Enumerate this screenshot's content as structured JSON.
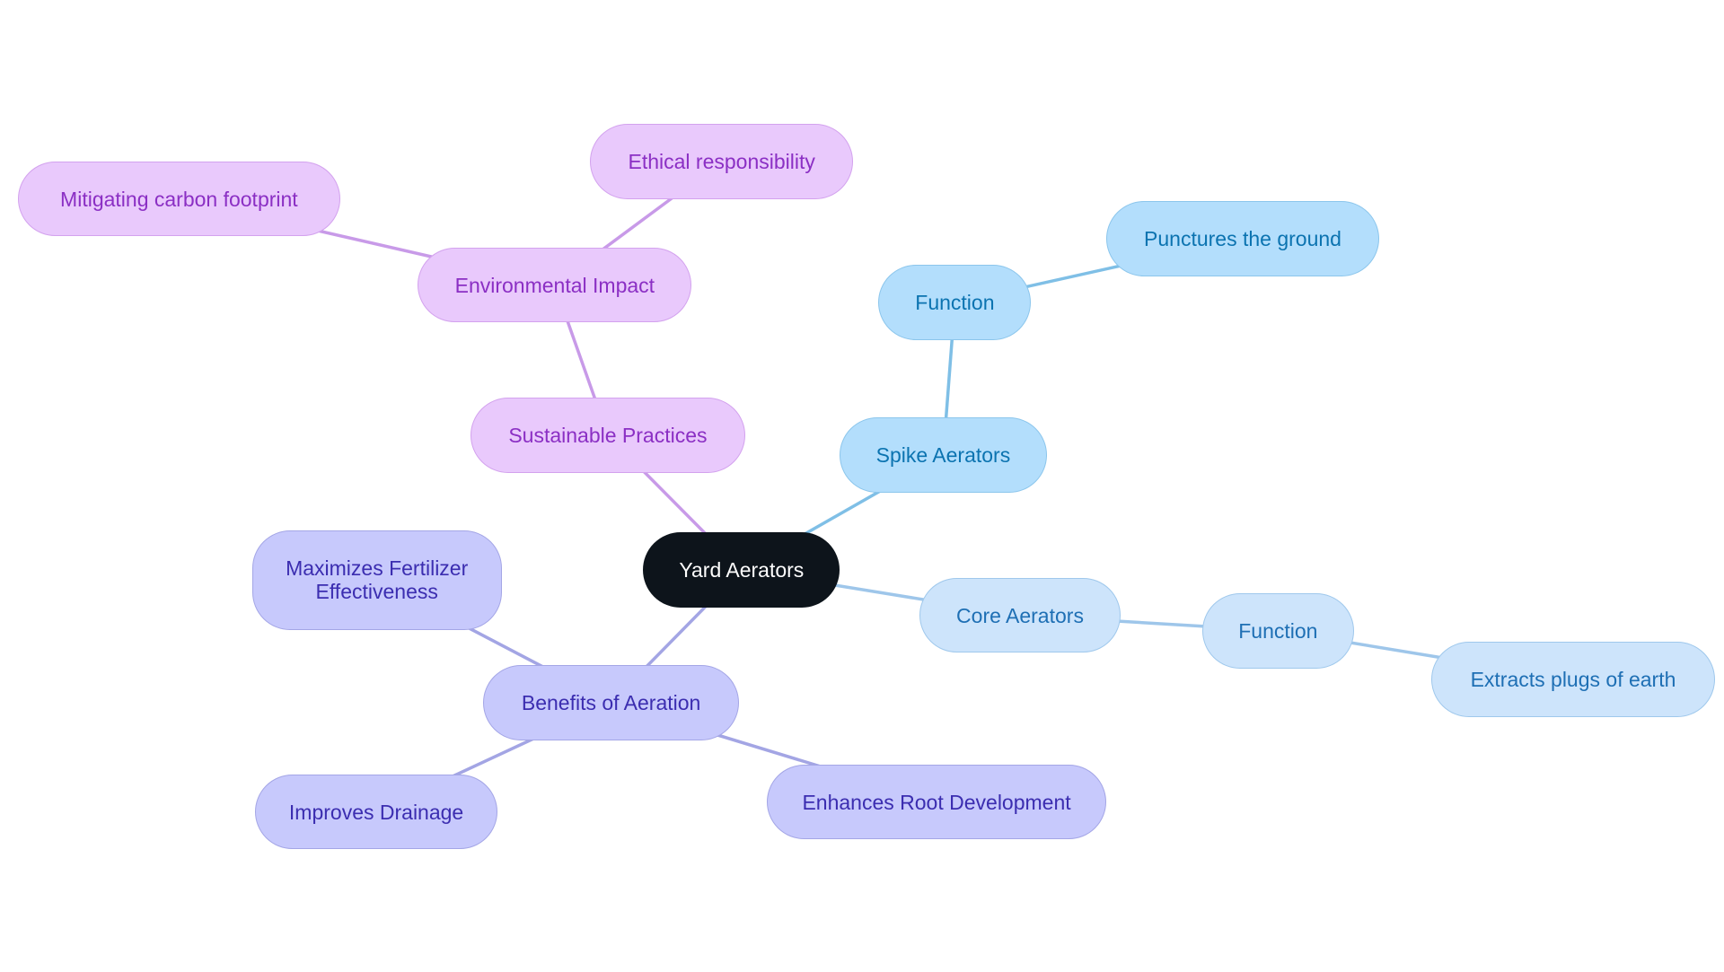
{
  "diagram": {
    "type": "mind-map",
    "root": "root",
    "nodes": [
      {
        "id": "root",
        "label": "Yard Aerators",
        "style": "root"
      },
      {
        "id": "sust",
        "label": "Sustainable Practices",
        "style": "purple"
      },
      {
        "id": "env",
        "label": "Environmental Impact",
        "style": "purple"
      },
      {
        "id": "eth",
        "label": "Ethical responsibility",
        "style": "purple"
      },
      {
        "id": "carb",
        "label": "Mitigating carbon footprint",
        "style": "purple"
      },
      {
        "id": "spike",
        "label": "Spike Aerators",
        "style": "blue"
      },
      {
        "id": "sfunc",
        "label": "Function",
        "style": "blue"
      },
      {
        "id": "punct",
        "label": "Punctures the ground",
        "style": "blue"
      },
      {
        "id": "core",
        "label": "Core Aerators",
        "style": "lblue"
      },
      {
        "id": "cfunc",
        "label": "Function",
        "style": "lblue"
      },
      {
        "id": "extr",
        "label": "Extracts plugs of earth",
        "style": "lblue"
      },
      {
        "id": "ben",
        "label": "Benefits of Aeration",
        "style": "indigo"
      },
      {
        "id": "fert",
        "label": "Maximizes Fertilizer\nEffectiveness",
        "style": "indigo"
      },
      {
        "id": "drain",
        "label": "Improves Drainage",
        "style": "indigo"
      },
      {
        "id": "rootdev",
        "label": "Enhances Root Development",
        "style": "indigo"
      }
    ],
    "edges": [
      {
        "from": "root",
        "to": "sust"
      },
      {
        "from": "sust",
        "to": "env"
      },
      {
        "from": "env",
        "to": "eth"
      },
      {
        "from": "env",
        "to": "carb"
      },
      {
        "from": "root",
        "to": "spike"
      },
      {
        "from": "spike",
        "to": "sfunc"
      },
      {
        "from": "sfunc",
        "to": "punct"
      },
      {
        "from": "root",
        "to": "core"
      },
      {
        "from": "core",
        "to": "cfunc"
      },
      {
        "from": "cfunc",
        "to": "extr"
      },
      {
        "from": "root",
        "to": "ben"
      },
      {
        "from": "ben",
        "to": "fert"
      },
      {
        "from": "ben",
        "to": "drain"
      },
      {
        "from": "ben",
        "to": "rootdev"
      }
    ],
    "colors": {
      "purple_edge": "#c89ae8",
      "blue_edge": "#7fbfe6",
      "lblue_edge": "#9ec6ea",
      "indigo_edge": "#a3a5e4"
    }
  }
}
